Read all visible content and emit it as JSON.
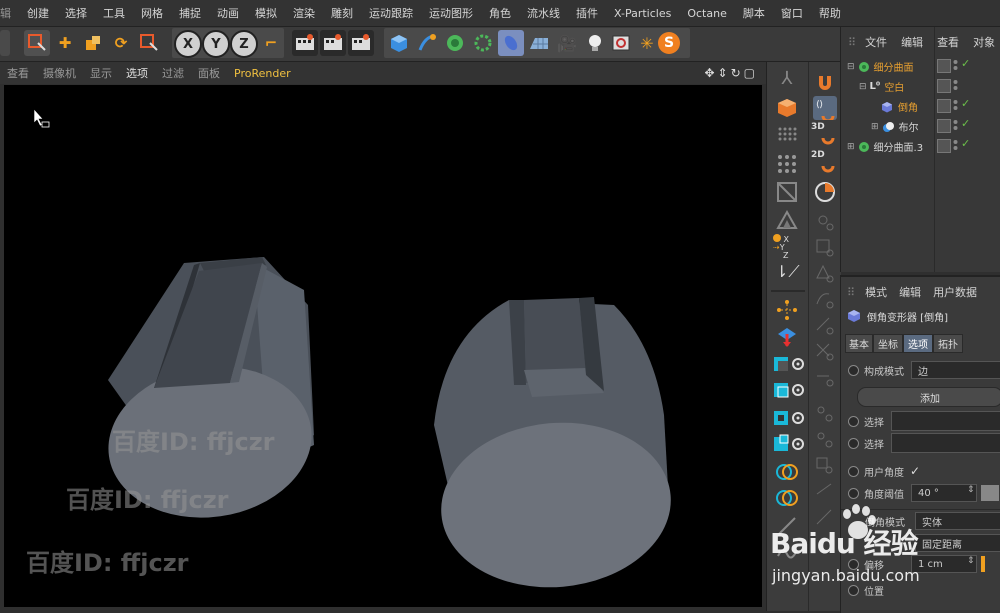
{
  "menu": {
    "items": [
      "辑",
      "创建",
      "选择",
      "工具",
      "网格",
      "捕捉",
      "动画",
      "模拟",
      "渲染",
      "雕刻",
      "运动跟踪",
      "运动图形",
      "角色",
      "流水线",
      "插件",
      "X-Particles",
      "Octane",
      "脚本",
      "窗口",
      "帮助"
    ]
  },
  "toolbar": {
    "axis_x": "X",
    "axis_y": "Y",
    "axis_z": "Z"
  },
  "viewport_menu": {
    "items": [
      "查看",
      "摄像机",
      "显示",
      "选项",
      "过滤",
      "面板"
    ],
    "prorender": "ProRender",
    "nav_icons": "✥⇕↻▢"
  },
  "strip": {
    "coord_x": "X",
    "coord_y": "Y",
    "coord_z": "Z",
    "label_3d": "3D",
    "label_2d": "2D"
  },
  "object_manager": {
    "menu": [
      "文件",
      "编辑",
      "查看",
      "对象"
    ],
    "objects": [
      {
        "name": "细分曲面",
        "indent": 0,
        "icon": "subdivision-icon"
      },
      {
        "name": "空白",
        "indent": 1,
        "icon": "null-icon"
      },
      {
        "name": "倒角",
        "indent": 2,
        "icon": "bevel-icon"
      },
      {
        "name": "布尔",
        "indent": 1,
        "icon": "boole-icon"
      },
      {
        "name": "细分曲面.3",
        "indent": 0,
        "icon": "subdivision-icon"
      }
    ],
    "check": "✓"
  },
  "attribute_manager": {
    "menu": [
      "模式",
      "编辑",
      "用户数据"
    ],
    "object_title": "倒角变形器 [倒角]",
    "tabs": [
      "基本",
      "坐标",
      "选项",
      "拓扑"
    ],
    "active_tab": "选项",
    "component_mode_label": "构成模式",
    "component_mode_value": "边",
    "add_button": "添加",
    "select_label": "选择",
    "select_label_2": "选择",
    "use_angle_label": "用户角度",
    "use_angle_check": "✓",
    "angle_threshold_label": "角度阈值",
    "angle_threshold_value": "40 °",
    "spinner": "⇕",
    "bevel_mode_label": "倒角模式",
    "bevel_mode_value": "实体",
    "offset_mode_value": "固定距离",
    "offset_label": "偏移",
    "offset_value": "1 cm",
    "position_label": "位置"
  },
  "watermarks": {
    "text": "百度ID: ffjczr",
    "baidu_logo": "Baidu 经验",
    "baidu_url": "jingyan.baidu.com"
  },
  "colors": {
    "accent_orange": "#e89a2c",
    "accent_blue": "#2c6fb5",
    "prorender_yellow": "#f0c040",
    "check_green": "#6cc04a"
  }
}
